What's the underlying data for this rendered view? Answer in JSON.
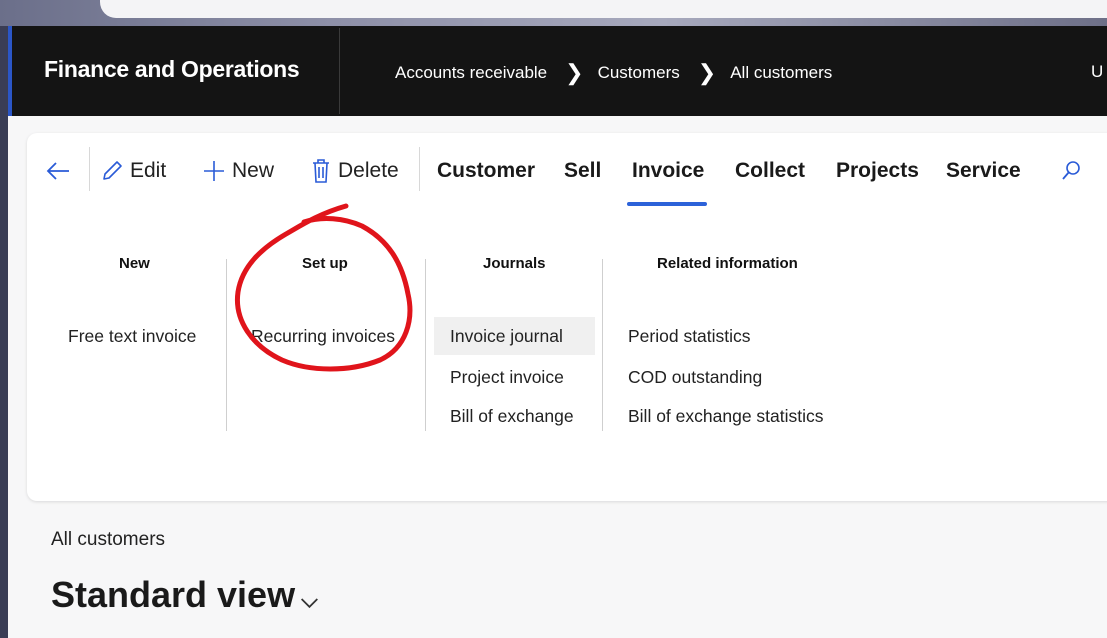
{
  "app": {
    "title": "Finance and Operations",
    "user_initial": "U"
  },
  "breadcrumb": [
    "Accounts receivable",
    "Customers",
    "All customers"
  ],
  "toolbar": {
    "edit_label": "Edit",
    "new_label": "New",
    "delete_label": "Delete"
  },
  "tabs": [
    "Customer",
    "Sell",
    "Invoice",
    "Collect",
    "Projects",
    "Service"
  ],
  "active_tab": "Invoice",
  "groups": [
    {
      "header": "New",
      "items": [
        "Free text invoice"
      ]
    },
    {
      "header": "Set up",
      "items": [
        "Recurring invoices"
      ]
    },
    {
      "header": "Journals",
      "items": [
        "Invoice journal",
        "Project invoice",
        "Bill of exchange"
      ]
    },
    {
      "header": "Related information",
      "items": [
        "Period statistics",
        "COD outstanding",
        "Bill of exchange statistics"
      ]
    }
  ],
  "page": {
    "subtitle": "All customers",
    "view": "Standard view"
  },
  "colors": {
    "accent": "#2c62d9",
    "annotation": "#e0141b",
    "header_bg": "#141414"
  }
}
